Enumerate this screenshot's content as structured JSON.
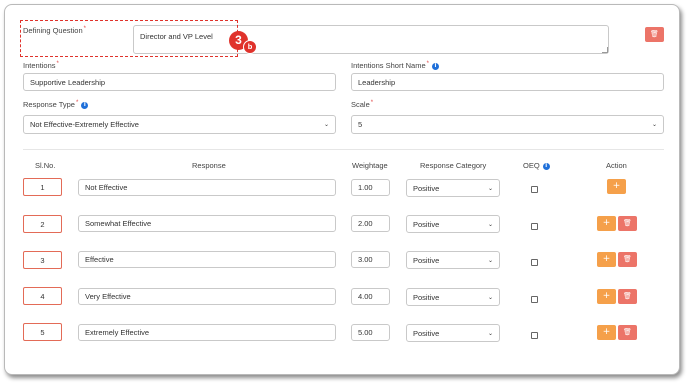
{
  "form": {
    "defining_question_label": "Defining Question",
    "defining_question_value": "Director and VP Level",
    "intentions_label": "Intentions",
    "intentions_value": "Supportive Leadership",
    "intentions_short_label": "Intentions Short Name",
    "intentions_short_value": "Leadership",
    "response_type_label": "Response Type",
    "response_type_value": "Not Effective-Extremely Effective",
    "scale_label": "Scale",
    "scale_value": "5",
    "required_mark": "*",
    "info_glyph": "i"
  },
  "annotation": {
    "number": "3",
    "letter": "b",
    "color": "#e0322b"
  },
  "table": {
    "headers": {
      "slno": "Sl.No.",
      "response": "Response",
      "weightage": "Weightage",
      "category": "Response Category",
      "oeq": "OEQ",
      "action": "Action"
    },
    "rows": [
      {
        "slno": "1",
        "response": "Not Effective",
        "weightage": "1.00",
        "category": "Positive"
      },
      {
        "slno": "2",
        "response": "Somewhat Effective",
        "weightage": "2.00",
        "category": "Positive"
      },
      {
        "slno": "3",
        "response": "Effective",
        "weightage": "3.00",
        "category": "Positive"
      },
      {
        "slno": "4",
        "response": "Very Effective",
        "weightage": "4.00",
        "category": "Positive"
      },
      {
        "slno": "5",
        "response": "Extremely Effective",
        "weightage": "5.00",
        "category": "Positive"
      }
    ]
  },
  "icons": {
    "add": "+",
    "delete": "🗑",
    "chevron": "⌄"
  },
  "colors": {
    "add_button": "#f5a04a",
    "delete_button": "#ec7468",
    "info": "#1e6fd9",
    "slno_border": "#e36b57"
  }
}
